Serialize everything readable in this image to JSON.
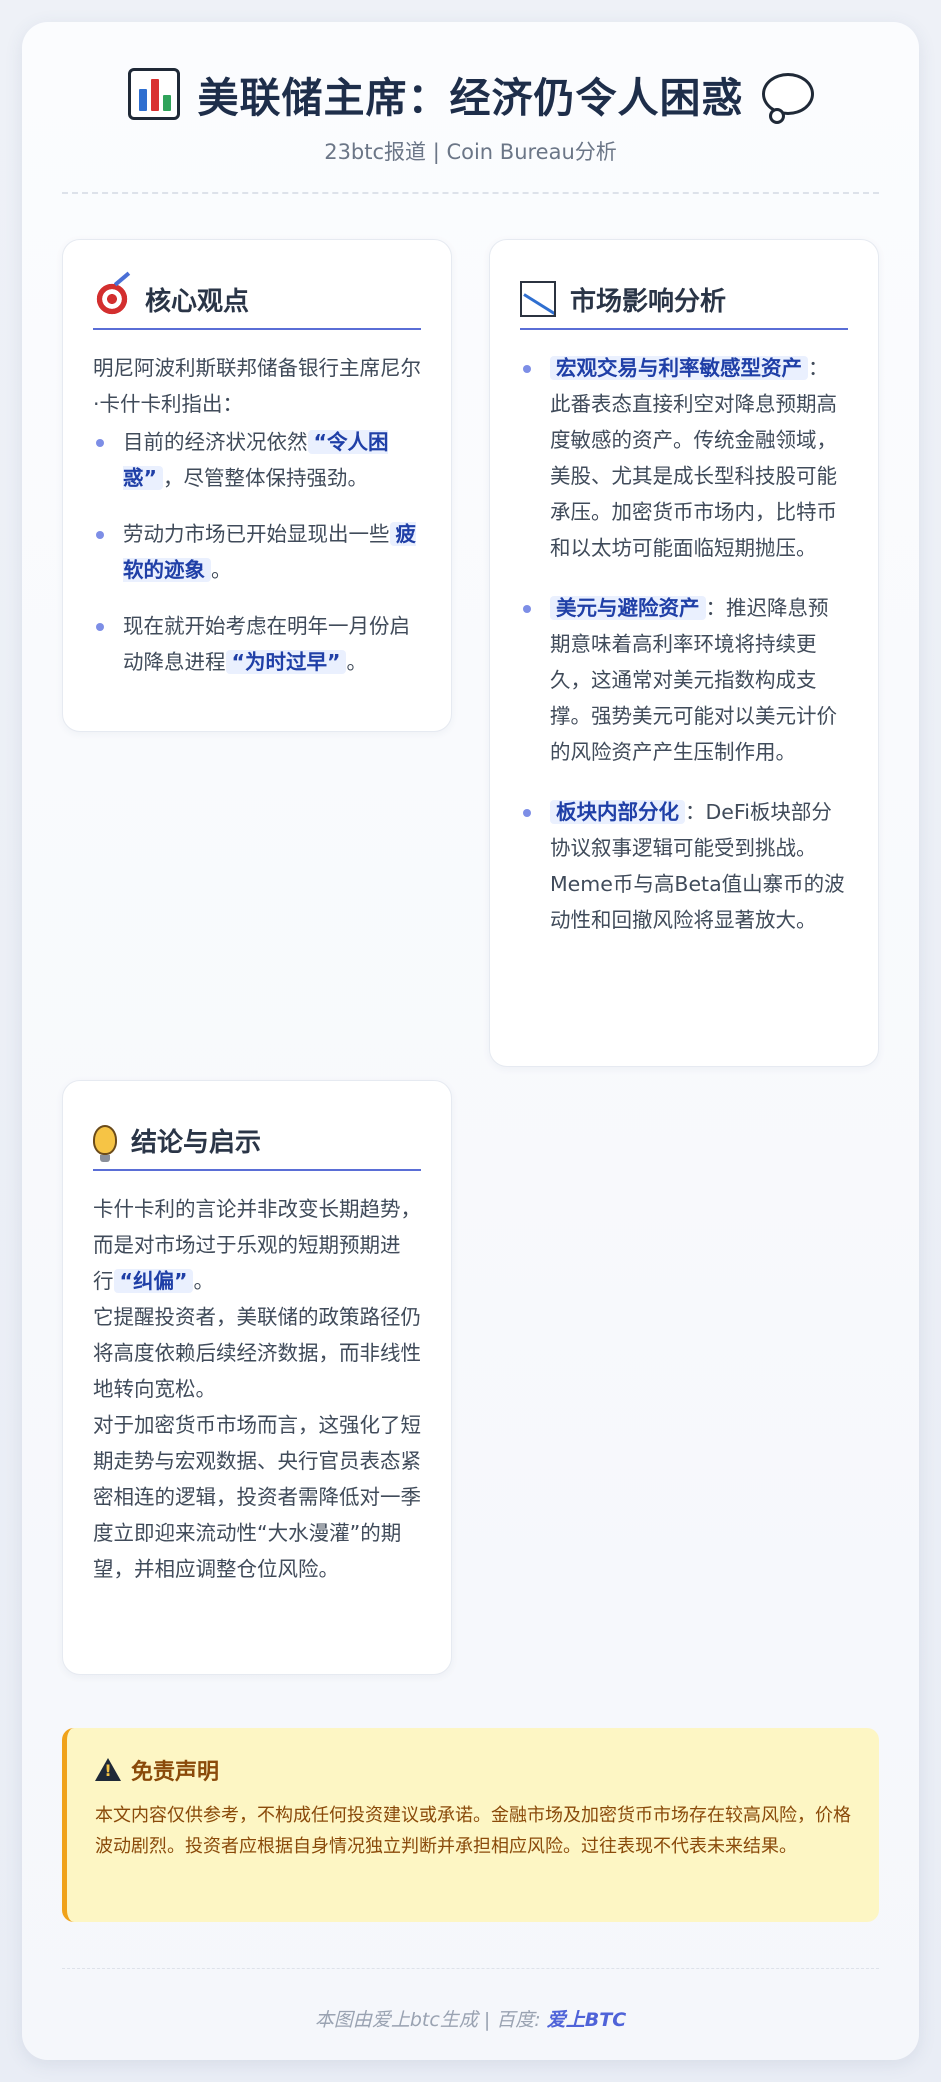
{
  "header": {
    "title": "美联储主席：经济仍令人困惑",
    "subtitle": "23btc报道 | Coin Bureau分析"
  },
  "core": {
    "title": "核心观点",
    "intro": "明尼阿波利斯联邦储备银行主席尼尔·卡什卡利指出：",
    "items": [
      {
        "pre": "目前的经济状况依然",
        "hl": "“令人困惑”",
        "post": "，尽管整体保持强劲。"
      },
      {
        "pre": "劳动力市场已开始显现出一些",
        "hl": "疲软的迹象",
        "post": "。"
      },
      {
        "pre": "现在就开始考虑在明年一月份启动降息进程",
        "hl": "“为时过早”",
        "post": "。"
      }
    ]
  },
  "market": {
    "title": "市场影响分析",
    "items": [
      {
        "hl": "宏观交易与利率敏感型资产",
        "text": "：此番表态直接利空对降息预期高度敏感的资产。传统金融领域，美股、尤其是成长型科技股可能承压。加密货币市场内，比特币和以太坊可能面临短期抛压。"
      },
      {
        "hl": "美元与避险资产",
        "text": "：推迟降息预期意味着高利率环境将持续更久，这通常对美元指数构成支撑。强势美元可能对以美元计价的风险资产产生压制作用。"
      },
      {
        "hl": "板块内部分化",
        "text": "：DeFi板块部分协议叙事逻辑可能受到挑战。Meme币与高Beta值山寨币的波动性和回撤风险将显著放大。"
      }
    ]
  },
  "conclusion": {
    "title": "结论与启示",
    "p1_pre": "卡什卡利的言论并非改变长期趋势，而是对市场过于乐观的短期预期进行",
    "p1_hl": "“纠偏”",
    "p1_post": "。",
    "p2": "它提醒投资者，美联储的政策路径仍将高度依赖后续经济数据，而非线性地转向宽松。",
    "p3": "对于加密货币市场而言，这强化了短期走势与宏观数据、央行官员表态紧密相连的逻辑，投资者需降低对一季度立即迎来流动性“大水漫灌”的期望，并相应调整仓位风险。"
  },
  "disclaimer": {
    "title": "免责声明",
    "text": "本文内容仅供参考，不构成任何投资建议或承诺。金融市场及加密货币市场存在较高风险，价格波动剧烈。投资者应根据自身情况独立判断并承担相应风险。过往表现不代表未来结果。"
  },
  "footer": {
    "text": "本图由爱上btc生成 | 百度: ",
    "brand": "爱上BTC"
  },
  "colors": {
    "accent": "#5a6ed6",
    "highlight_text": "#1f3fa7",
    "highlight_bg": "#eaf0fe",
    "warning_bg": "#fdf6c4",
    "warning_border": "#f0a21a"
  },
  "icons": {
    "title_left": "bar-chart-icon",
    "title_right": "thought-bubble-icon",
    "core": "target-icon",
    "market": "chart-decreasing-icon",
    "conclusion": "light-bulb-icon",
    "disclaimer": "warning-icon"
  }
}
